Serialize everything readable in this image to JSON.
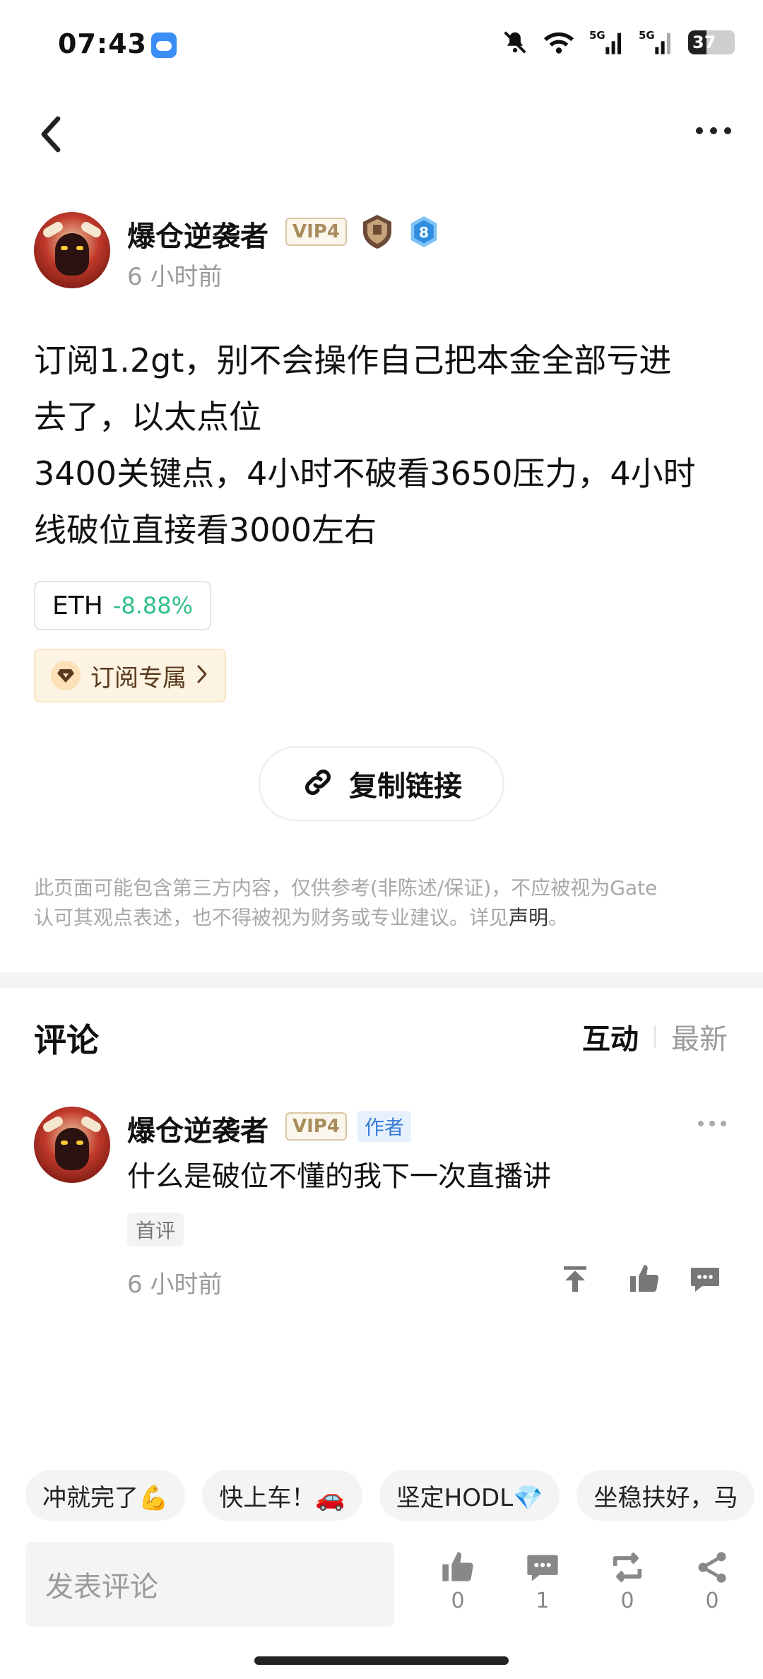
{
  "status": {
    "time": "07:43",
    "battery": "37"
  },
  "post": {
    "author": "爆仓逆袭者",
    "vip": "VIP4",
    "level": "8",
    "time": "6 小时前",
    "lines": [
      "订阅1.2gt，别不会操作自己把本金全部亏进",
      "去了，以太点位",
      "3400关键点，4小时不破看3650压力，4小时",
      "线破位直接看3000左右"
    ],
    "token": {
      "symbol": "ETH",
      "change": "-8.88%"
    },
    "subscription_label": "订阅专属",
    "copy_link_label": "复制链接",
    "disclaimer_line1": "此页面可能包含第三方内容，仅供参考(非陈述/保证)，不应被视为Gate",
    "disclaimer_line2": "认可其观点表述，也不得被视为财务或专业建议。详见",
    "disclaimer_link": "声明",
    "disclaimer_end": "。"
  },
  "comments": {
    "title": "评论",
    "sort_active": "互动",
    "sort_inactive": "最新",
    "items": [
      {
        "author": "爆仓逆袭者",
        "vip": "VIP4",
        "author_tag": "作者",
        "text": "什么是破位不懂的我下一次直播讲",
        "tag": "首评",
        "time": "6 小时前"
      }
    ]
  },
  "quick_replies": [
    "冲就完了💪",
    "快上车！🚗",
    "坚定HODL💎",
    "坐稳扶好，马"
  ],
  "bottom_bar": {
    "input_placeholder": "发表评论",
    "likes": "0",
    "comments": "1",
    "reposts": "0",
    "shares": "0"
  },
  "colors": {
    "positive": "#2fbf87",
    "accent_blue": "#3a7bd5",
    "vip_gold": "#a88c5d"
  }
}
